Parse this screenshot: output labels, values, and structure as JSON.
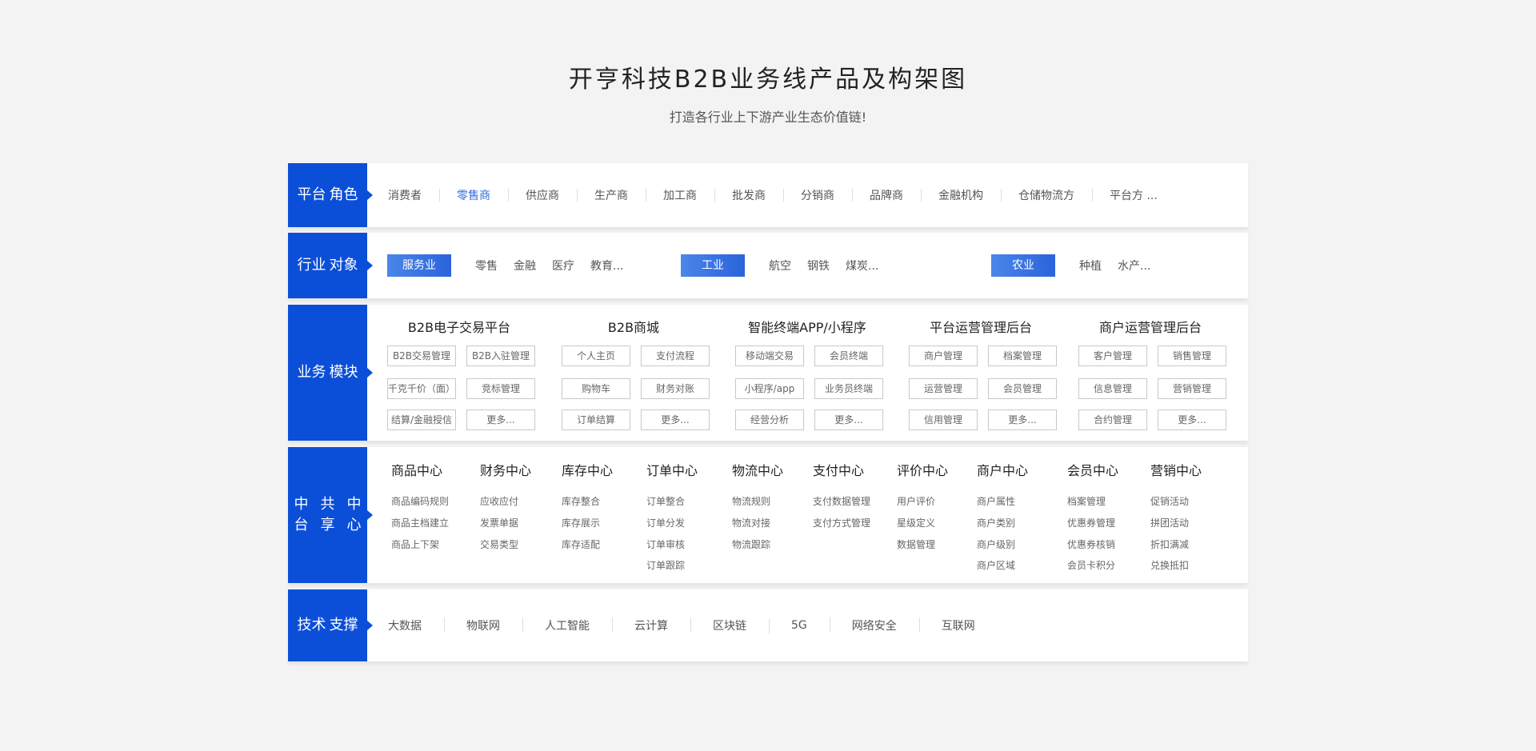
{
  "title": "开亨科技B2B业务线产品及构架图",
  "subtitle": "打造各行业上下游产业生态价值链!",
  "platform_roles": {
    "label": [
      "平台",
      "角色"
    ],
    "items": [
      "消费者",
      "零售商",
      "供应商",
      "生产商",
      "加工商",
      "批发商",
      "分销商",
      "品牌商",
      "金融机构",
      "仓储物流方",
      "平台方 ..."
    ],
    "active": "零售商"
  },
  "industries": {
    "label": [
      "行业",
      "对象"
    ],
    "groups": [
      {
        "tag": "服务业",
        "items": [
          "零售",
          "金融",
          "医疗",
          "教育..."
        ]
      },
      {
        "tag": "工业",
        "items": [
          "航空",
          "钢铁",
          "煤炭..."
        ]
      },
      {
        "tag": "农业",
        "items": [
          "种植",
          "水产..."
        ]
      }
    ]
  },
  "business_modules": {
    "label": [
      "业务",
      "模块"
    ],
    "modules": [
      {
        "title": "B2B电子交易平台",
        "items": [
          "B2B交易管理",
          "B2B入驻管理",
          "千克千价（面）",
          "竞标管理",
          "结算/金融授信",
          "更多..."
        ]
      },
      {
        "title": "B2B商城",
        "items": [
          "个人主页",
          "支付流程",
          "购物车",
          "财务对账",
          "订单结算",
          "更多..."
        ]
      },
      {
        "title": "智能终端APP/小程序",
        "items": [
          "移动端交易",
          "会员终端",
          "小程序/app",
          "业务员终端",
          "经营分析",
          "更多..."
        ]
      },
      {
        "title": "平台运营管理后台",
        "items": [
          "商户管理",
          "档案管理",
          "运营管理",
          "会员管理",
          "信用管理",
          "更多..."
        ]
      },
      {
        "title": "商户运营管理后台",
        "items": [
          "客户管理",
          "销售管理",
          "信息管理",
          "营销管理",
          "合约管理",
          "更多..."
        ]
      }
    ]
  },
  "middle_platform": {
    "label": [
      "中台",
      "共享",
      "中心"
    ],
    "centers": [
      {
        "title": "商品中心",
        "items": [
          "商品编码规则",
          "商品主档建立",
          "商品上下架"
        ]
      },
      {
        "title": "财务中心",
        "items": [
          "应收应付",
          "发票单据",
          "交易类型"
        ]
      },
      {
        "title": "库存中心",
        "items": [
          "库存整合",
          "库存展示",
          "库存适配"
        ]
      },
      {
        "title": "订单中心",
        "items": [
          "订单整合",
          "订单分发",
          "订单审核",
          "订单跟踪"
        ]
      },
      {
        "title": "物流中心",
        "items": [
          "物流规则",
          "物流对接",
          "物流跟踪"
        ]
      },
      {
        "title": "支付中心",
        "items": [
          "支付数据管理",
          "支付方式管理"
        ]
      },
      {
        "title": "评价中心",
        "items": [
          "用户评价",
          "星级定义",
          "数据管理"
        ]
      },
      {
        "title": "商户中心",
        "items": [
          "商户属性",
          "商户类别",
          "商户级别",
          "商户区域"
        ]
      },
      {
        "title": "会员中心",
        "items": [
          "档案管理",
          "优惠券管理",
          "优惠券核销",
          "会员卡积分"
        ]
      },
      {
        "title": "营销中心",
        "items": [
          "促销活动",
          "拼团活动",
          "折扣满减",
          "兑换抵扣"
        ]
      }
    ]
  },
  "tech_support": {
    "label": [
      "技术",
      "支撑"
    ],
    "items": [
      "大数据",
      "物联网",
      "人工智能",
      "云计算",
      "区块链",
      "5G",
      "网络安全",
      "互联网"
    ]
  }
}
